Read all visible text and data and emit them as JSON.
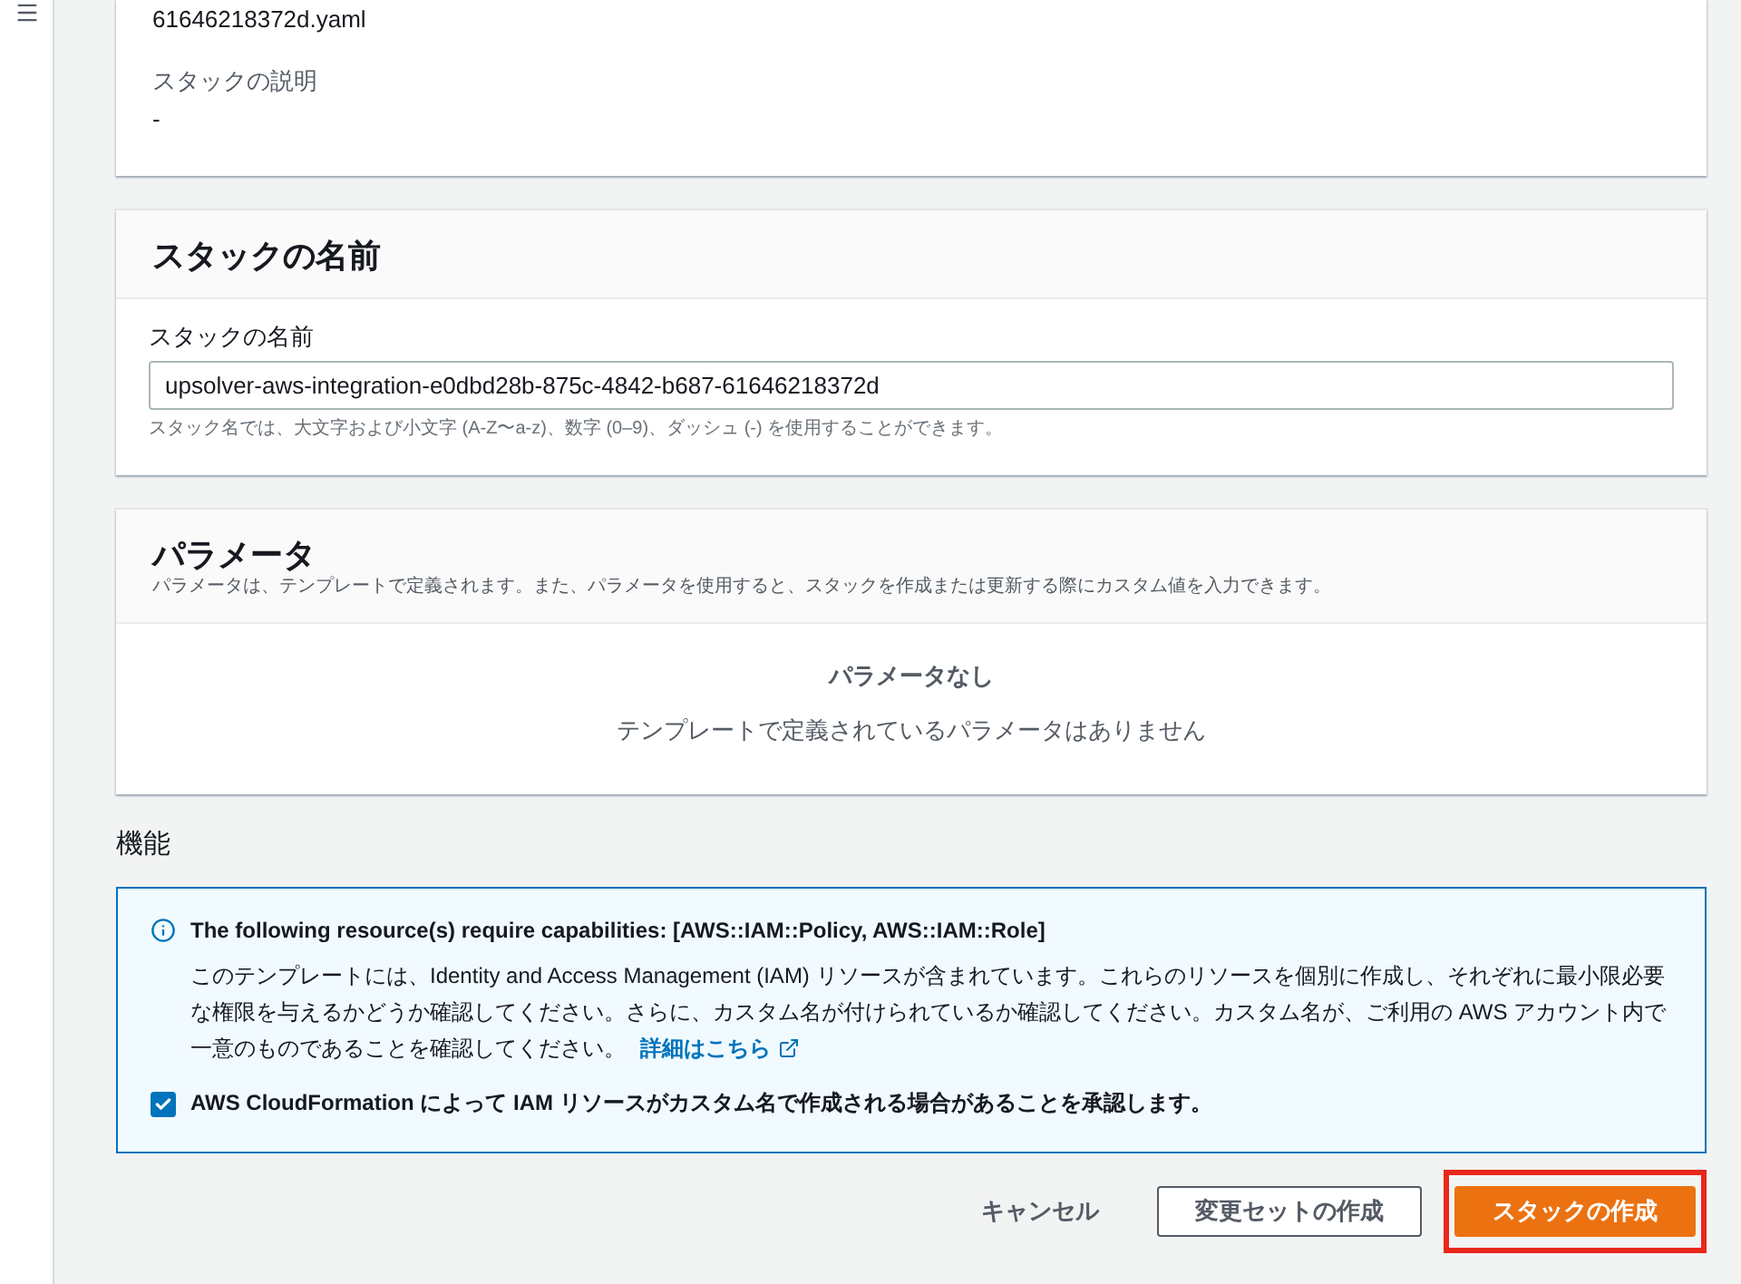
{
  "template_file": {
    "value": "61646218372d.yaml"
  },
  "stack_description": {
    "label": "スタックの説明",
    "value": "-"
  },
  "stack_name_section": {
    "title": "スタックの名前",
    "field_label": "スタックの名前",
    "value": "upsolver-aws-integration-e0dbd28b-875c-4842-b687-61646218372d",
    "hint": "スタック名では、大文字および小文字 (A-Z〜a-z)、数字 (0–9)、ダッシュ (-) を使用することができます。"
  },
  "parameters_section": {
    "title": "パラメータ",
    "description": "パラメータは、テンプレートで定義されます。また、パラメータを使用すると、スタックを作成または更新する際にカスタム値を入力できます。",
    "empty_title": "パラメータなし",
    "empty_text": "テンプレートで定義されているパラメータはありません"
  },
  "capabilities": {
    "title": "機能",
    "alert_title": "The following resource(s) require capabilities: [AWS::IAM::Policy, AWS::IAM::Role]",
    "alert_text": "このテンプレートには、Identity and Access Management (IAM) リソースが含まれています。これらのリソースを個別に作成し、それぞれに最小限必要な権限を与えるかどうか確認してください。さらに、カスタム名が付けられているか確認してください。カスタム名が、ご利用の AWS アカウント内で一意のものであることを確認してください。",
    "link": "詳細はこちら",
    "acknowledge": {
      "label": "AWS CloudFormation によって IAM リソースがカスタム名で作成される場合があることを承認します。",
      "checked": true
    }
  },
  "buttons": [
    {
      "label": "キャンセル",
      "kind": "link"
    },
    {
      "label": "変更セットの作成",
      "kind": "normal"
    },
    {
      "label": "スタックの作成",
      "kind": "primary",
      "highlighted": true
    }
  ]
}
